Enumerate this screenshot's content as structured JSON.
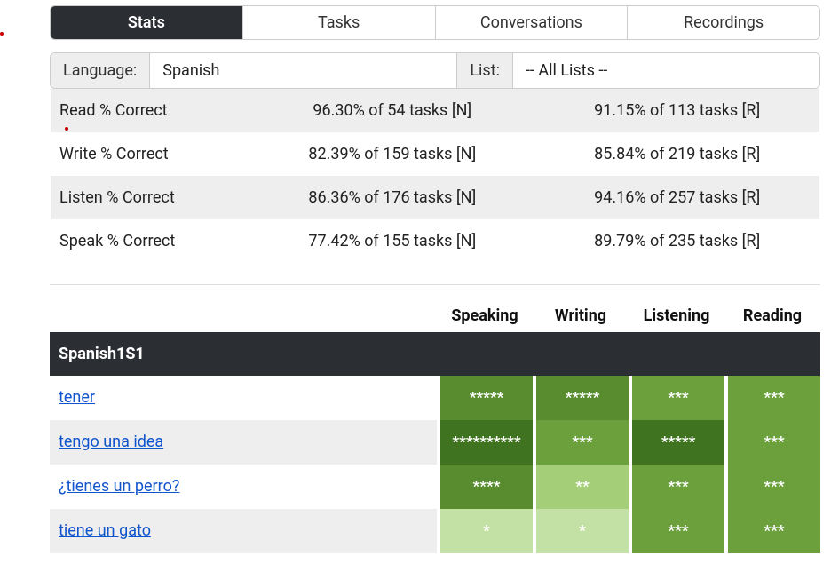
{
  "tabs": {
    "stats": "Stats",
    "tasks": "Tasks",
    "conversations": "Conversations",
    "recordings": "Recordings"
  },
  "filters": {
    "language_label": "Language:",
    "language_value": "Spanish",
    "list_label": "List:",
    "list_value": "-- All Lists --"
  },
  "stats": {
    "rows": [
      {
        "label": "Read % Correct",
        "n": "96.30% of 54 tasks [N]",
        "r": "91.15% of 113 tasks [R]"
      },
      {
        "label": "Write % Correct",
        "n": "82.39% of 159 tasks [N]",
        "r": "85.84% of 219 tasks [R]"
      },
      {
        "label": "Listen % Correct",
        "n": "86.36% of 176 tasks [N]",
        "r": "94.16% of 257 tasks [R]"
      },
      {
        "label": "Speak % Correct",
        "n": "77.42% of 155 tasks [N]",
        "r": "89.79% of 235 tasks [R]"
      }
    ]
  },
  "skills": {
    "columns": {
      "speaking": "Speaking",
      "writing": "Writing",
      "listening": "Listening",
      "reading": "Reading"
    },
    "section": "Spanish1S1",
    "rows": [
      {
        "word": "tener",
        "speaking": {
          "stars": "*****",
          "level": 4
        },
        "writing": {
          "stars": "*****",
          "level": 4
        },
        "listening": {
          "stars": "***",
          "level": 3
        },
        "reading": {
          "stars": "***",
          "level": 3
        }
      },
      {
        "word": "tengo una idea",
        "speaking": {
          "stars": "**********",
          "level": 5
        },
        "writing": {
          "stars": "***",
          "level": 3
        },
        "listening": {
          "stars": "*****",
          "level": 5
        },
        "reading": {
          "stars": "***",
          "level": 3
        }
      },
      {
        "word": "¿tienes un perro?",
        "speaking": {
          "stars": "****",
          "level": 4
        },
        "writing": {
          "stars": "**",
          "level": 1
        },
        "listening": {
          "stars": "***",
          "level": 3
        },
        "reading": {
          "stars": "***",
          "level": 3
        }
      },
      {
        "word": "tiene un gato",
        "speaking": {
          "stars": "*",
          "level": 0
        },
        "writing": {
          "stars": "*",
          "level": 0
        },
        "listening": {
          "stars": "***",
          "level": 3
        },
        "reading": {
          "stars": "***",
          "level": 3
        }
      }
    ]
  }
}
